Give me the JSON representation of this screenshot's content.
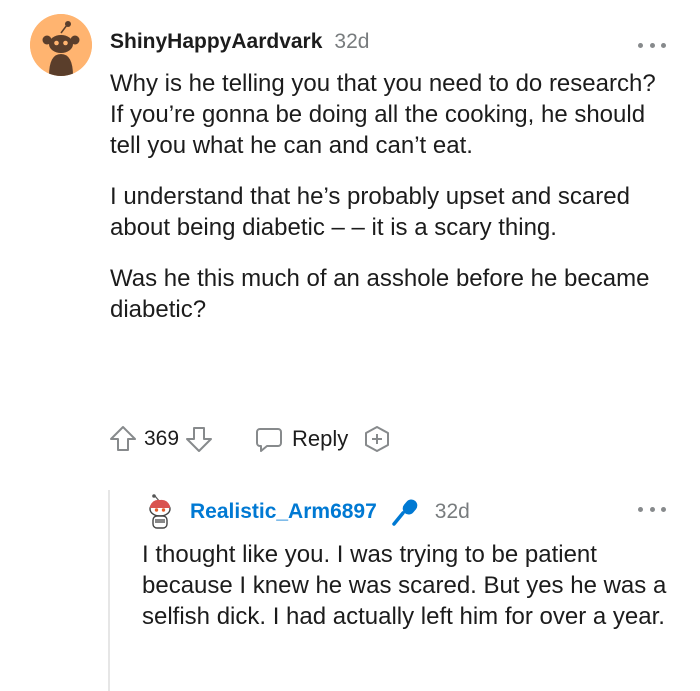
{
  "comment": {
    "username": "ShinyHappyAardvark",
    "time": "32d",
    "paragraphs": [
      "Why is he telling you that you need to do research? If you’re gonna be doing all the cooking, he should tell you what he can and can’t eat.",
      "I understand that he’s probably upset and scared about being diabetic – – it is a scary thing.",
      "Was he this much of an asshole before he became diabetic?"
    ],
    "votes": "369",
    "reply_label": "Reply",
    "avatar_color": "#ffb470",
    "icons": {
      "upvote": "upvote-arrow-icon",
      "downvote": "downvote-arrow-icon",
      "reply": "speech-bubble-icon",
      "award": "add-award-icon",
      "more": "more-options-icon"
    }
  },
  "reply": {
    "username": "Realistic_Arm6897",
    "time": "32d",
    "text": "I thought like you. I was trying to be patient because I knew he was scared. But yes he was a selfish dick. I had actually left him for over a year.",
    "username_color": "#0079d3",
    "icons": {
      "flair": "microphone-icon",
      "more": "more-options-icon"
    }
  }
}
